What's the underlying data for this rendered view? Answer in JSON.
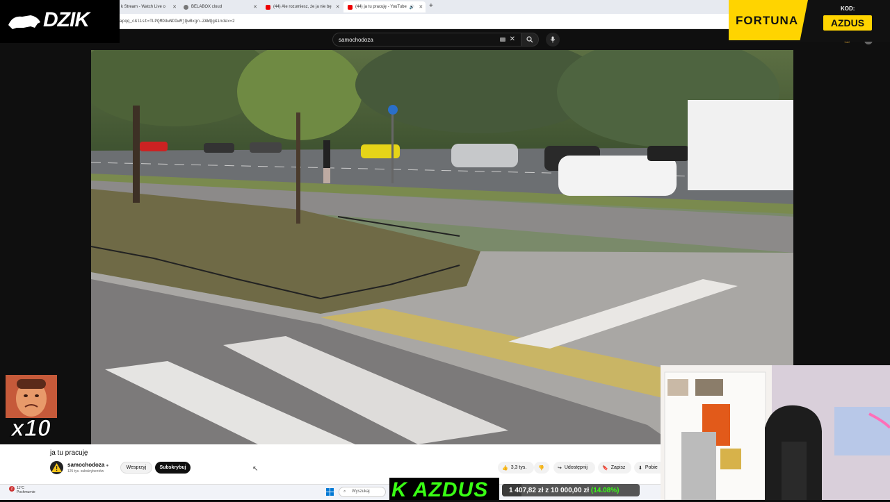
{
  "browser": {
    "tabs": [
      {
        "label": "k Stream - Watch Live o"
      },
      {
        "label": "BELABOX cloud"
      },
      {
        "label": "(44) Ale rozumiesz, że ja nie bę"
      },
      {
        "label": "(44) ja tu pracuję - YouTube"
      }
    ],
    "url": "apqq_c&list=TLPQMDUwNDIwMjQwBxgn-ZAWQg&index=2"
  },
  "youtube": {
    "search_value": "samochodoza",
    "video_title": "ja tu pracuję",
    "channel_name": "samochodoza",
    "channel_subs": "125 tys. subskrybentów",
    "support_label": "Wesprzyj",
    "subscribe_label": "Subskrybuj",
    "likes": "3,3 tys.",
    "share_label": "Udostępnij",
    "save_label": "Zapisz",
    "download_label": "Pobie"
  },
  "overlay": {
    "brand": "DZIK",
    "sponsor": "FORTUNA",
    "code_label": "KOD:",
    "code": "AZDUS",
    "multiplier": "x10",
    "banner": "K AZDUS",
    "goal": {
      "current": "1 407,82 zł",
      "separator": "z",
      "target": "10 000,00 zł",
      "percent": "(14.08%)",
      "fraction": 0.1408
    }
  },
  "taskbar": {
    "temp": "11°C",
    "weather": "Pochmurnie",
    "search": "Wyszukaj",
    "notif_count": "2"
  },
  "colors": {
    "accent_green": "#39ff14",
    "fortuna_yellow": "#ffd400"
  }
}
